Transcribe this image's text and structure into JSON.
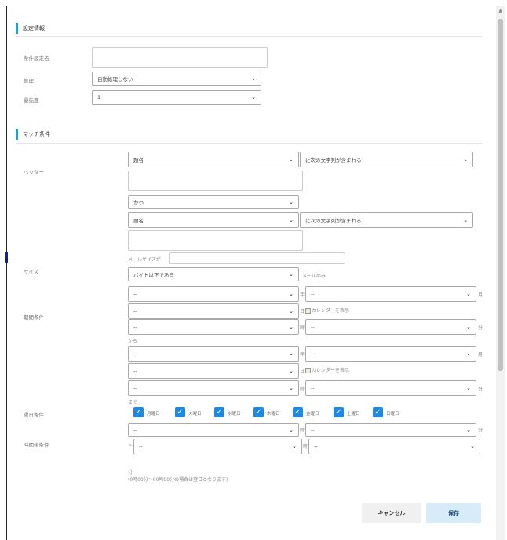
{
  "sections": {
    "settings_title": "設定情報",
    "match_title": "マッチ条件"
  },
  "settings": {
    "name_label": "条件設定名",
    "name_value": "",
    "process_label": "処理",
    "process_value": "自動処理しない",
    "priority_label": "優先度",
    "priority_value": "1"
  },
  "header_cond": {
    "label": "ヘッダー",
    "field1": "題名",
    "op1": "に次の文字列が含まれる",
    "text1": "",
    "conj": "かつ",
    "field2": "題名",
    "op2": "に次の文字列が含まれる",
    "text2": ""
  },
  "size_cond": {
    "label": "サイズ",
    "prefix": "メールサイズが",
    "value": "",
    "op": "バイト以下である",
    "suffix": "メールのみ"
  },
  "period_cond": {
    "label": "期間条件",
    "dash": "--",
    "unit_year": "年",
    "unit_month": "月",
    "unit_day": "日",
    "unit_hour": "時",
    "unit_min": "分",
    "calendar_text": "カレンダーを表示",
    "from": "から",
    "to": "まで"
  },
  "weekday_cond": {
    "label": "曜日条件",
    "days": [
      "月曜日",
      "火曜日",
      "水曜日",
      "木曜日",
      "金曜日",
      "土曜日",
      "日曜日"
    ]
  },
  "time_cond": {
    "label": "時間帯条件",
    "tilde": "～",
    "note_unit": "分",
    "note": "(0時00分～00時00分の場合は翌日となります)"
  },
  "buttons": {
    "cancel": "キャンセル",
    "save": "保存"
  }
}
